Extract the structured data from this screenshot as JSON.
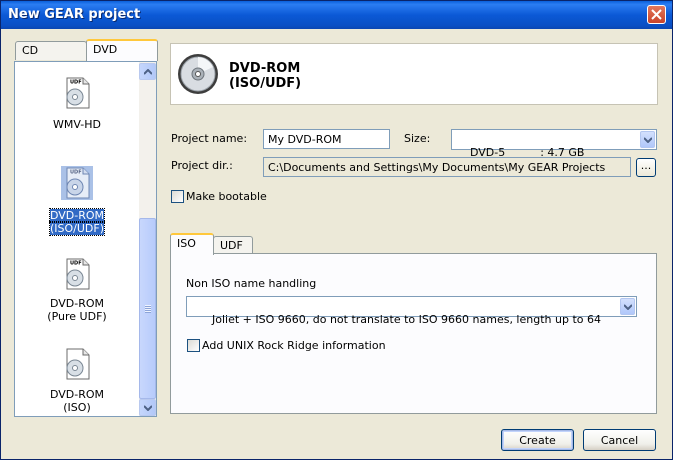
{
  "window": {
    "title": "New GEAR project"
  },
  "left_panel": {
    "tabs": [
      {
        "label": "CD",
        "active": false
      },
      {
        "label": "DVD",
        "active": true
      }
    ],
    "items": [
      {
        "label": "WMV-HD",
        "badge": "UDF",
        "icon": "disc-document-icon",
        "selected": false
      },
      {
        "label_lines": [
          "DVD-ROM",
          "(ISO/UDF)"
        ],
        "badge": "UDF",
        "icon": "disc-document-icon",
        "selected": true
      },
      {
        "label_lines": [
          "DVD-ROM",
          "(Pure UDF)"
        ],
        "badge": "UDF",
        "icon": "disc-document-icon",
        "selected": false
      },
      {
        "label_lines": [
          "DVD-ROM",
          "(ISO)"
        ],
        "badge": "",
        "icon": "disc-document-icon",
        "selected": false
      }
    ]
  },
  "header": {
    "icon": "dvd-disc-icon",
    "title_line1": "DVD-ROM",
    "title_line2": "(ISO/UDF)"
  },
  "form": {
    "project_name_label": "Project name:",
    "project_name_value": "My DVD-ROM",
    "size_label": "Size:",
    "size_value": "DVD-5          : 4.7 GB",
    "project_dir_label": "Project dir.:",
    "project_dir_value": "C:\\Documents and Settings\\My Documents\\My GEAR Projects",
    "browse_label": "...",
    "make_bootable_label": "Make bootable",
    "make_bootable_checked": false
  },
  "settings": {
    "tabs": [
      {
        "label": "ISO",
        "active": true
      },
      {
        "label": "UDF",
        "active": false
      }
    ],
    "non_iso_label": "Non ISO name handling",
    "non_iso_value": "Joliet + ISO 9660, do not translate to ISO 9660 names, length up to 64",
    "rock_ridge_label": "Add UNIX Rock Ridge information",
    "rock_ridge_checked": false
  },
  "buttons": {
    "create": "Create",
    "cancel": "Cancel"
  },
  "colors": {
    "title_bar": "#0b59d6",
    "selection": "#316ac5",
    "tab_highlight": "#ffc83c",
    "dialog_bg": "#ece9d8"
  }
}
